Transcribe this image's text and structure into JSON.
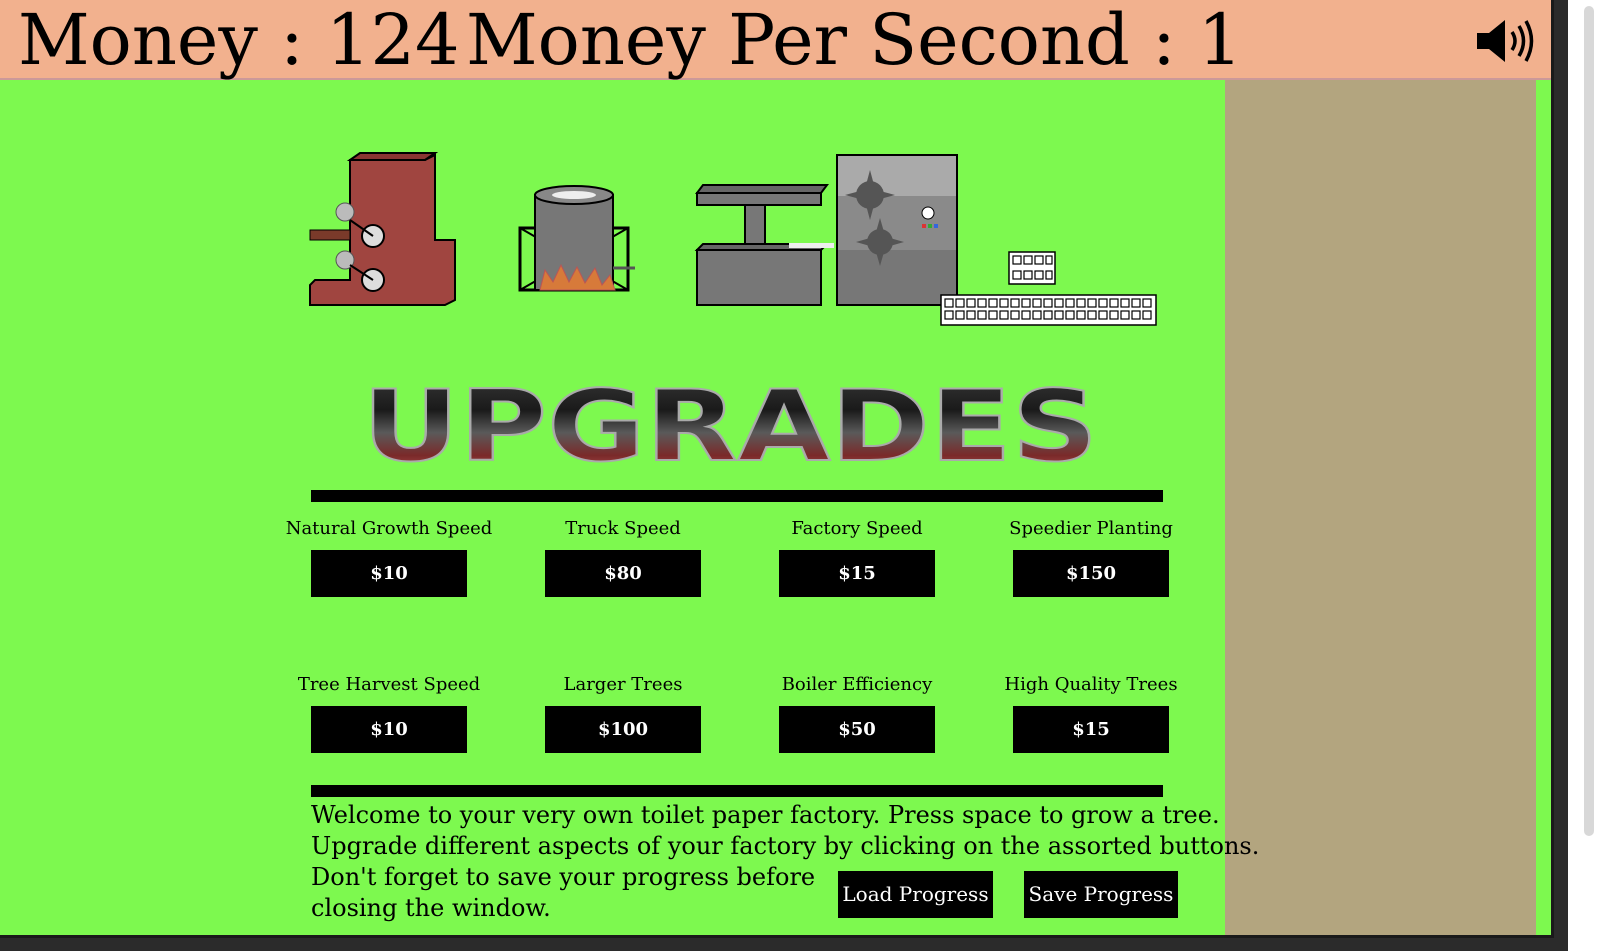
{
  "header": {
    "money_text": "Money : 124",
    "mps_text": "Money Per Second : 1",
    "sound_icon": "speaker-icon"
  },
  "section_title": "UPGRADES",
  "upgrades": [
    {
      "label": "Natural Growth Speed",
      "price": "$10"
    },
    {
      "label": "Truck Speed",
      "price": "$80"
    },
    {
      "label": "Factory Speed",
      "price": "$15"
    },
    {
      "label": "Speedier Planting",
      "price": "$150"
    },
    {
      "label": "Tree Harvest Speed",
      "price": "$10"
    },
    {
      "label": "Larger Trees",
      "price": "$100"
    },
    {
      "label": "Boiler Efficiency",
      "price": "$50"
    },
    {
      "label": "High Quality Trees",
      "price": "$15"
    }
  ],
  "intro": {
    "line1": "Welcome to your very own toilet paper factory. Press space to grow a tree.",
    "line2": "Upgrade different aspects of your factory by clicking on the assorted buttons.",
    "line3": "Don't forget to save your progress before",
    "line4": "closing the window."
  },
  "buttons": {
    "load": "Load Progress",
    "save": "Save Progress"
  },
  "colors": {
    "background": "#7df94f",
    "topbar": "#f2b18e",
    "sidebar": "#b3a57f",
    "button": "#000000",
    "saw_machine": "#a04540"
  }
}
